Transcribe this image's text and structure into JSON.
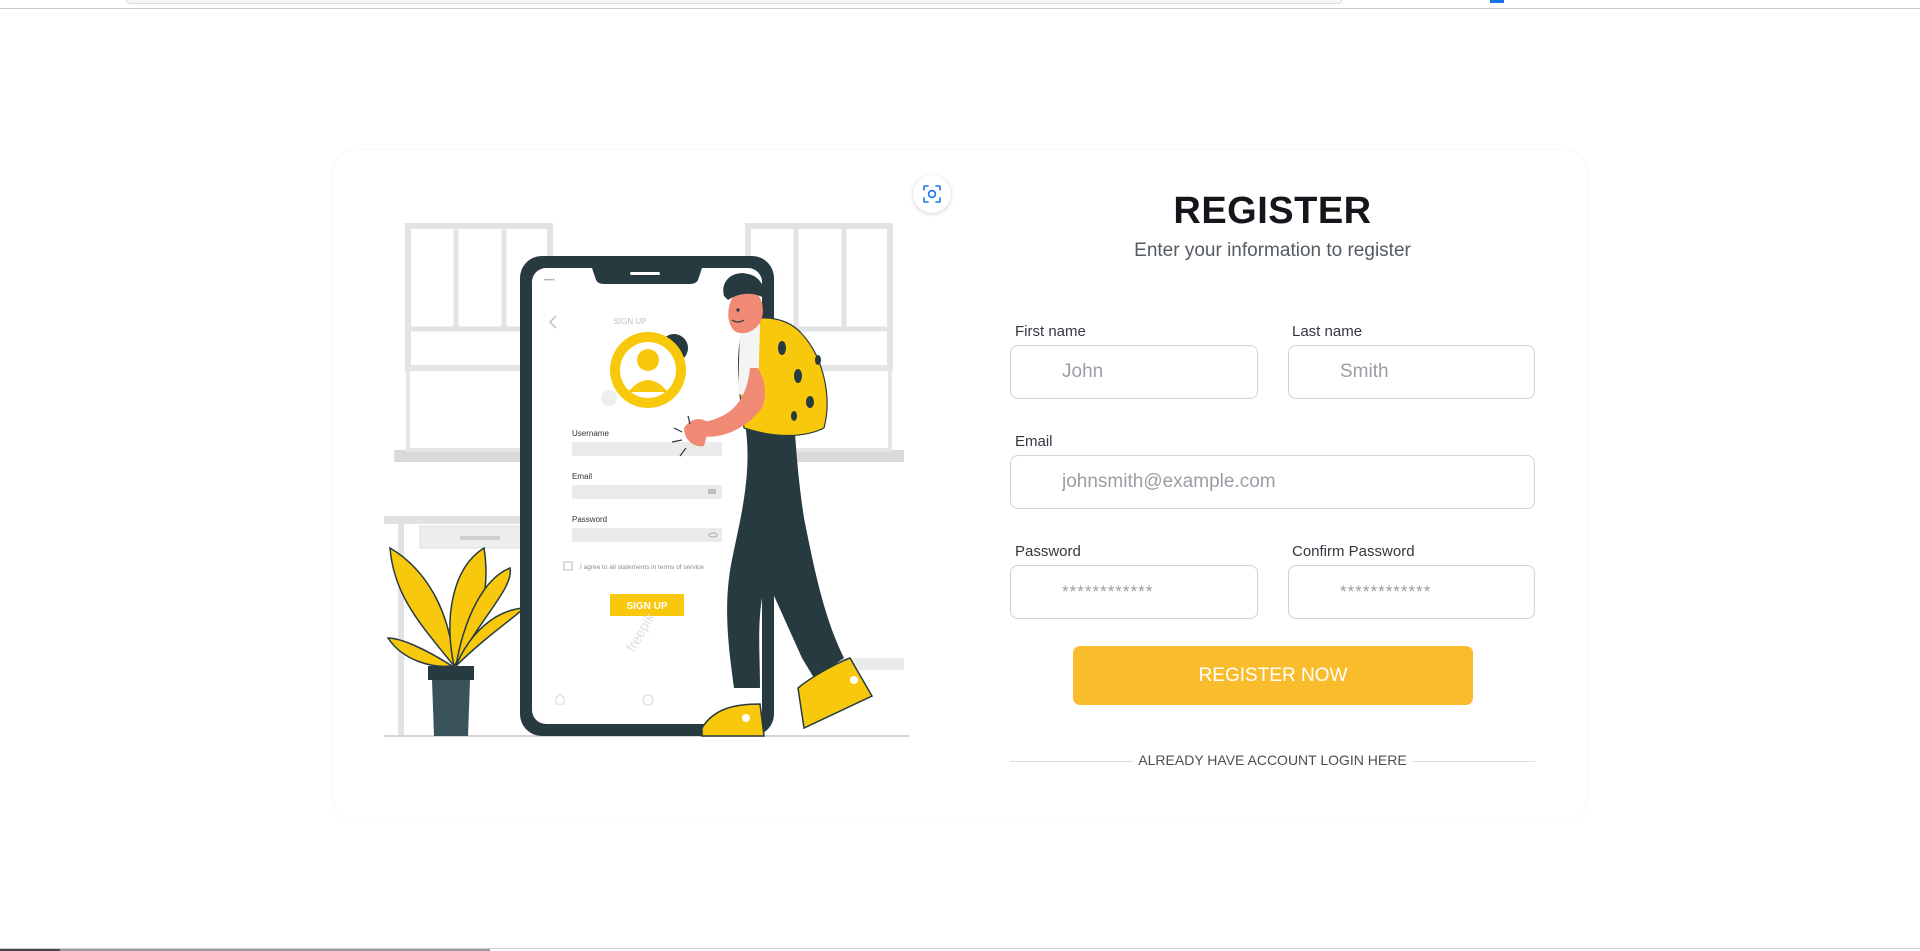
{
  "form": {
    "title": "REGISTER",
    "subtitle": "Enter your information to register",
    "first_name_label": "First name",
    "first_name_placeholder": "John",
    "last_name_label": "Last name",
    "last_name_placeholder": "Smith",
    "email_label": "Email",
    "email_placeholder": "johnsmith@example.com",
    "password_label": "Password",
    "password_placeholder": "************",
    "confirm_password_label": "Confirm Password",
    "confirm_password_placeholder": "************",
    "submit_label": "REGISTER NOW",
    "login_link": "ALREADY HAVE ACCOUNT LOGIN HERE"
  },
  "illustration": {
    "phone_heading": "SIGN UP",
    "username_label": "Username",
    "email_label": "Email",
    "password_label": "Password",
    "terms_text": "I agree to all statements in terms of service",
    "signup_button": "SIGN UP",
    "watermark": "freepik"
  },
  "colors": {
    "accent": "#f8bc2c",
    "title": "#14161c",
    "dark_teal": "#263a40"
  }
}
